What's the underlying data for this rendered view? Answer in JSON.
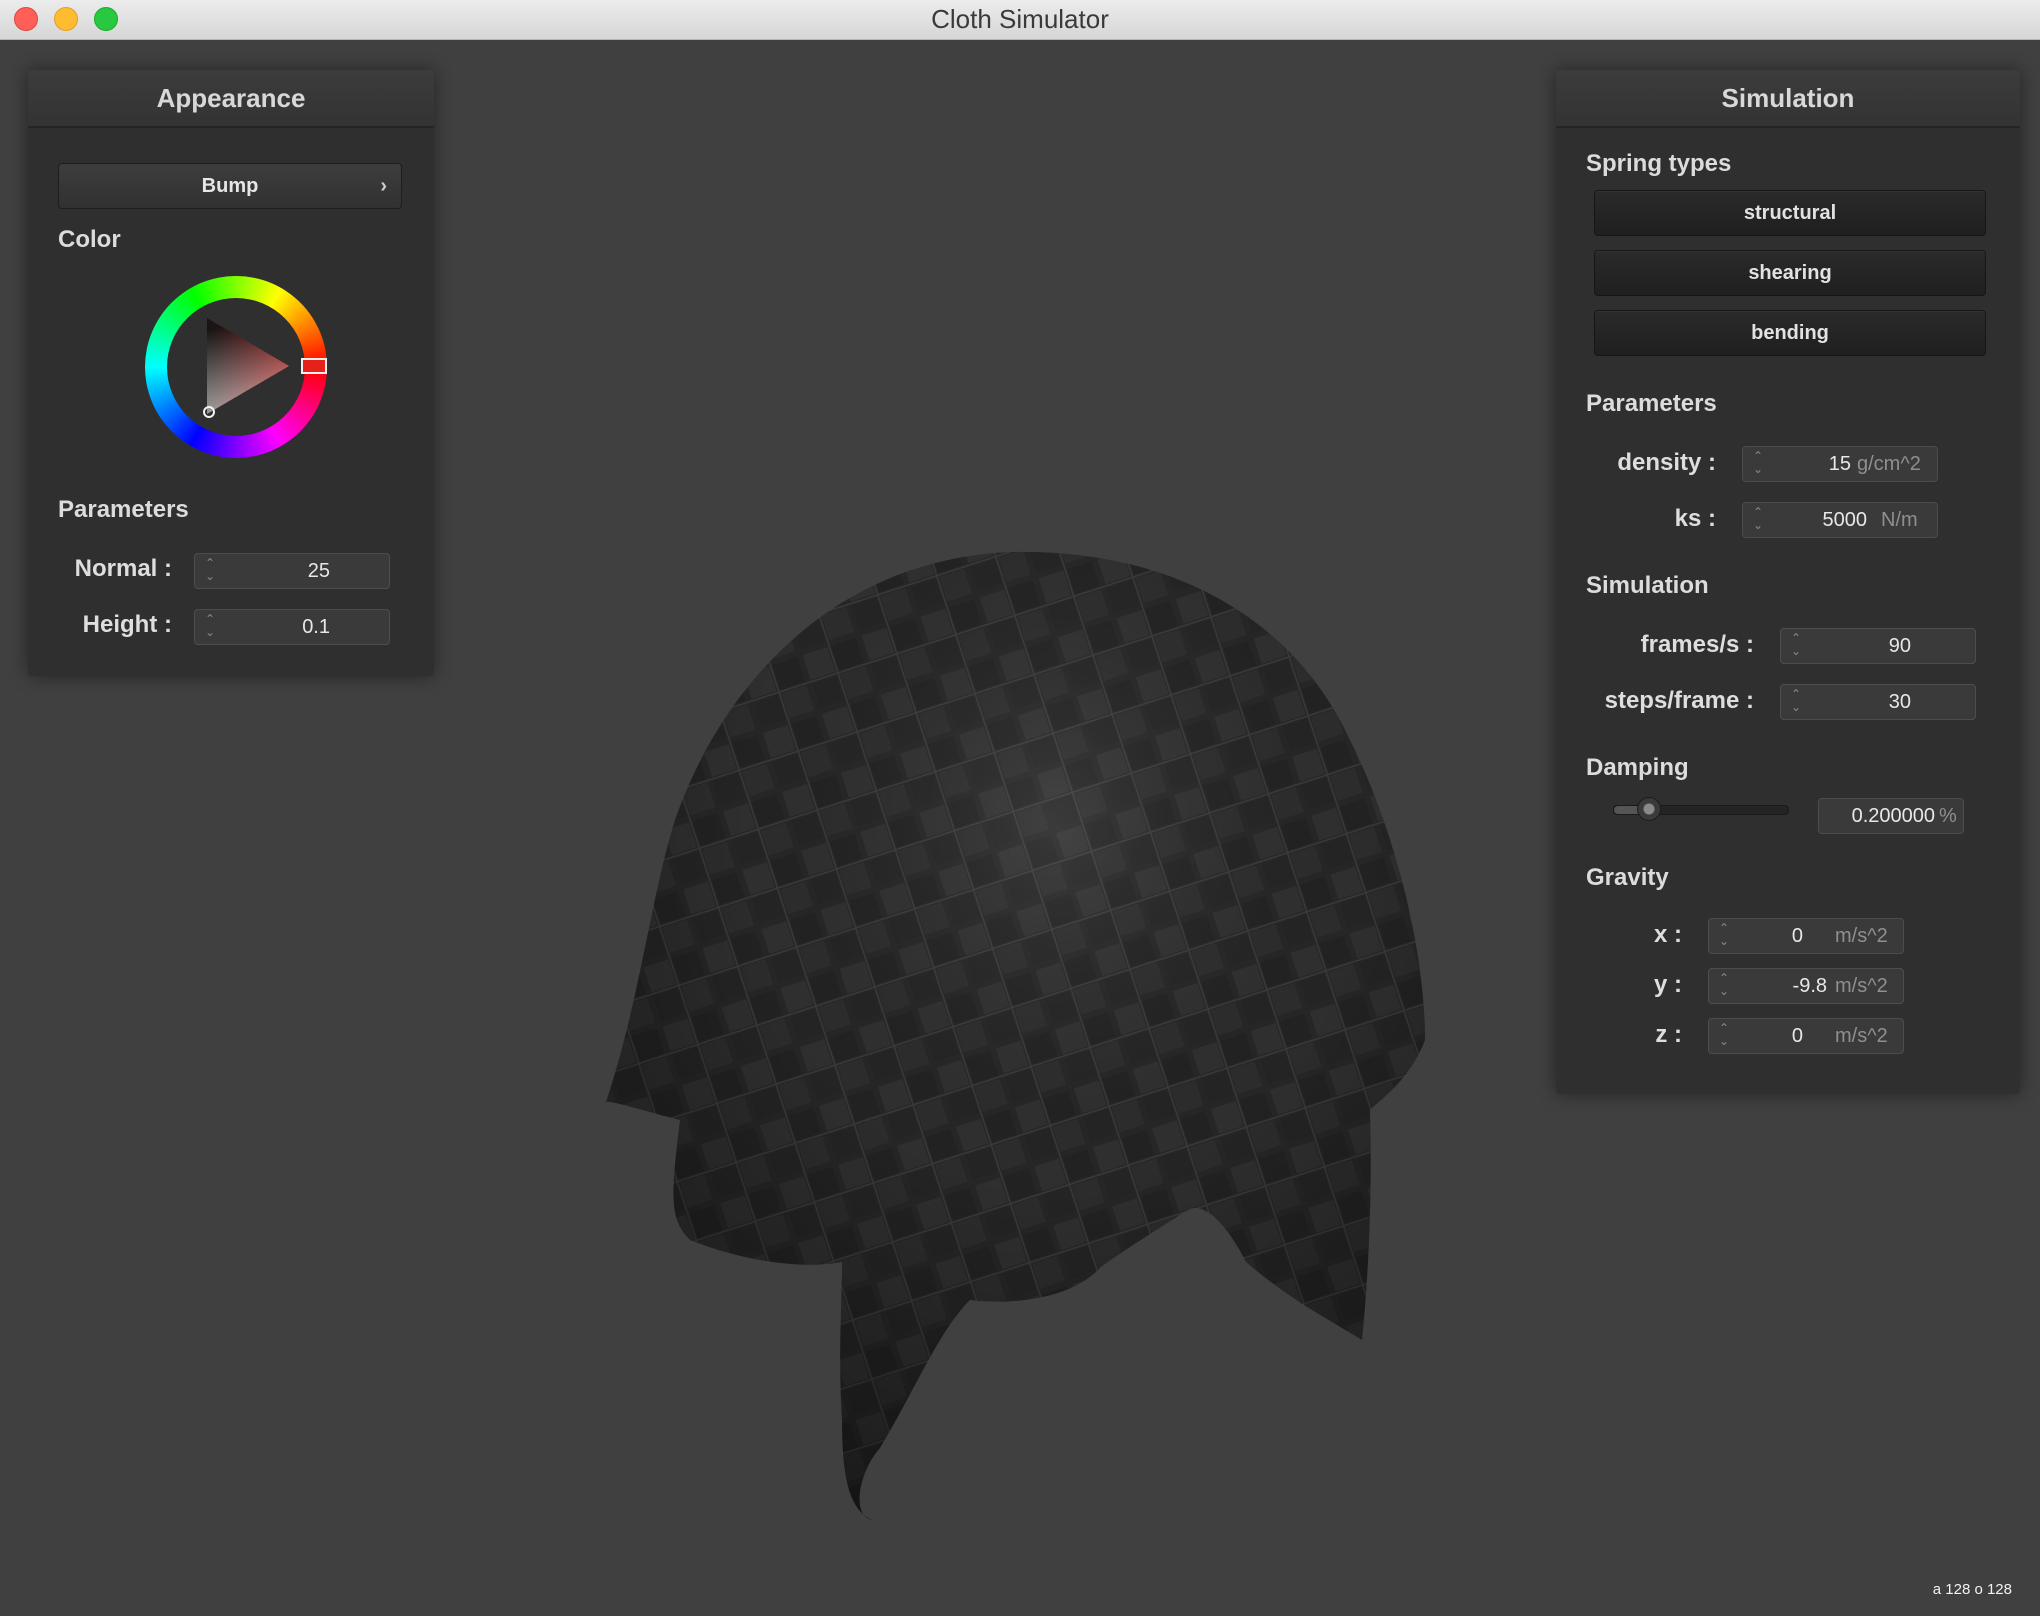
{
  "window": {
    "title": "Cloth Simulator"
  },
  "appearance": {
    "header": "Appearance",
    "shader": "Bump",
    "color_label": "Color",
    "color_selected": "#e8201a",
    "params_label": "Parameters",
    "normal_label": "Normal :",
    "normal_value": "25",
    "height_label": "Height :",
    "height_value": "0.1"
  },
  "simulation": {
    "header": "Simulation",
    "spring_types_label": "Spring types",
    "spring_types": [
      "structural",
      "shearing",
      "bending"
    ],
    "params_label": "Parameters",
    "density_label": "density :",
    "density_value": "15",
    "density_unit": "g/cm^2",
    "ks_label": "ks :",
    "ks_value": "5000",
    "ks_unit": "N/m",
    "sim_label": "Simulation",
    "fps_label": "frames/s :",
    "fps_value": "90",
    "steps_label": "steps/frame :",
    "steps_value": "30",
    "damping_label": "Damping",
    "damping_value": "0.200000",
    "damping_unit": "%",
    "damping_fraction": 0.2,
    "gravity_label": "Gravity",
    "gx_label": "x :",
    "gx_value": "0",
    "gy_label": "y :",
    "gy_value": "-9.8",
    "gz_label": "z :",
    "gz_value": "0",
    "gravity_unit": "m/s^2"
  },
  "status": "a 128 o 128"
}
